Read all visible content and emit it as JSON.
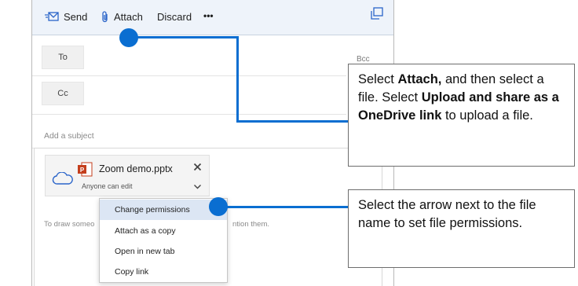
{
  "toolbar": {
    "send_label": "Send",
    "attach_label": "Attach",
    "discard_label": "Discard",
    "more_label": "•••",
    "popout_icon": "popout-icon"
  },
  "fields": {
    "to_label": "To",
    "cc_label": "Cc",
    "bcc_label": "Bcc",
    "subject_placeholder": "Add a subject"
  },
  "attachment": {
    "file_name": "Zoom demo.pptx",
    "permission": "Anyone can edit",
    "cloud_icon": "onedrive-cloud-icon",
    "file_icon": "powerpoint-file-icon"
  },
  "body": {
    "hint_left": "To draw someo",
    "hint_right": "ntion them."
  },
  "menu": {
    "items": [
      "Change permissions",
      "Attach as a copy",
      "Open in new tab",
      "Copy link"
    ]
  },
  "callouts": {
    "attach": {
      "t1": "Select ",
      "b1": "Attach,",
      "t2": " and then select a file. Select ",
      "b2": "Upload and share as a OneDrive link",
      "t3": " to upload a file."
    },
    "arrow": {
      "text": "Select the arrow next to the file name to set file permissions."
    }
  },
  "colors": {
    "accent": "#0a6ed1",
    "toolbar_bg": "#eef3fa",
    "menu_highlight": "#dce6f4"
  }
}
